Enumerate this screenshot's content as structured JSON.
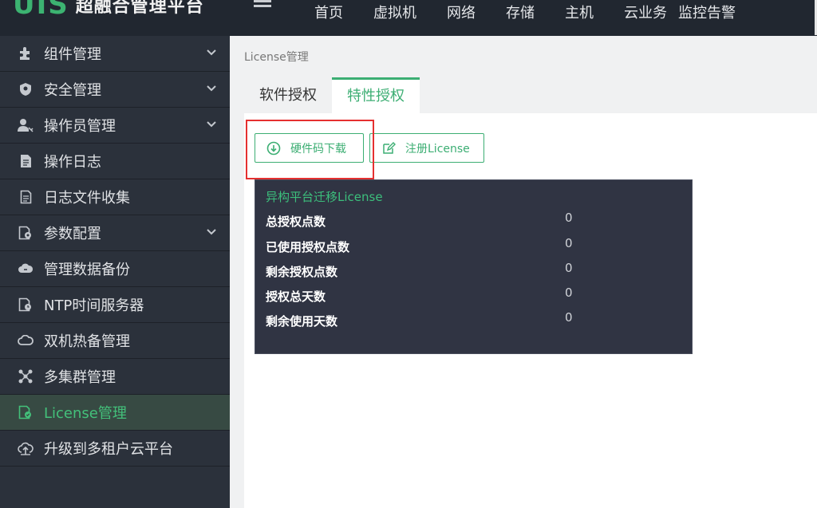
{
  "header": {
    "logo_mark": "UIS",
    "logo_text": "超融合管理平台",
    "nav": [
      "首页",
      "虚拟机",
      "网络",
      "存储",
      "主机",
      "云业务",
      "监控告警"
    ]
  },
  "sidebar": {
    "items": [
      {
        "label": "组件管理",
        "icon": "puzzle-icon",
        "expandable": true
      },
      {
        "label": "安全管理",
        "icon": "shield-icon",
        "expandable": true
      },
      {
        "label": "操作员管理",
        "icon": "user-key-icon",
        "expandable": true
      },
      {
        "label": "操作日志",
        "icon": "document-icon",
        "expandable": false
      },
      {
        "label": "日志文件收集",
        "icon": "file-collect-icon",
        "expandable": false
      },
      {
        "label": "参数配置",
        "icon": "settings-doc-icon",
        "expandable": true
      },
      {
        "label": "管理数据备份",
        "icon": "cloud-backup-icon",
        "expandable": false
      },
      {
        "label": "NTP时间服务器",
        "icon": "clock-doc-icon",
        "expandable": false
      },
      {
        "label": "双机热备管理",
        "icon": "cloud-sync-icon",
        "expandable": false
      },
      {
        "label": "多集群管理",
        "icon": "cluster-icon",
        "expandable": false
      },
      {
        "label": "License管理",
        "icon": "license-icon",
        "expandable": false,
        "active": true
      },
      {
        "label": "升级到多租户云平台",
        "icon": "cloud-upgrade-icon",
        "expandable": false
      }
    ]
  },
  "main": {
    "breadcrumb": "License管理",
    "tabs": [
      {
        "label": "软件授权",
        "active": false
      },
      {
        "label": "特性授权",
        "active": true
      }
    ],
    "buttons": {
      "hardware_download": "硬件码下载",
      "register_license": "注册License"
    },
    "license": {
      "title": "异构平台迁移License",
      "rows": [
        {
          "label": "总授权点数",
          "value": "0"
        },
        {
          "label": "已使用授权点数",
          "value": "0"
        },
        {
          "label": "剩余授权点数",
          "value": "0"
        },
        {
          "label": "授权总天数",
          "value": "0"
        },
        {
          "label": "剩余使用天数",
          "value": "0"
        }
      ]
    }
  },
  "colors": {
    "accent": "#3cae73",
    "topbar": "#212730",
    "sidebar": "#2b313b",
    "panel": "#303443",
    "highlight": "#e53030"
  }
}
